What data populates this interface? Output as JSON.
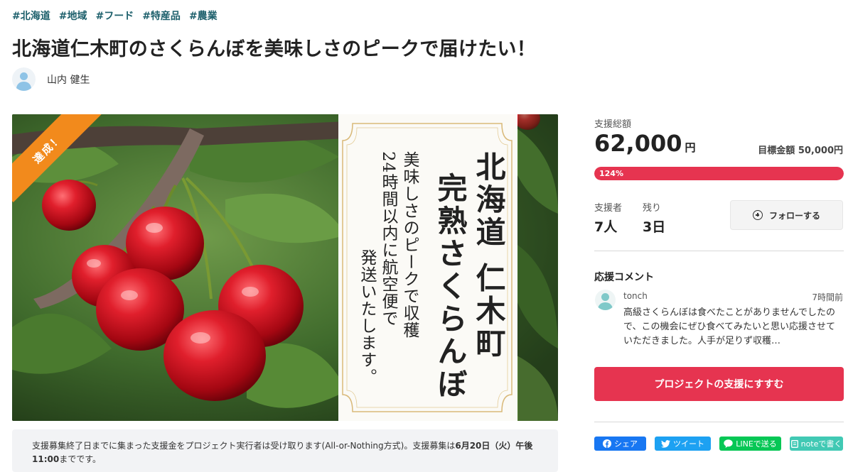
{
  "tags": [
    "#北海道",
    "#地域",
    "#フード",
    "#特産品",
    "#農業"
  ],
  "title": "北海道仁木町のさくらんぼを美味しさのピークで届けたい！",
  "owner": {
    "name": "山内 健生"
  },
  "hero": {
    "ribbon": "達成！",
    "poster_lines": [
      "北海道 仁木町",
      "完熟さくらんぼ",
      "美味しさのピークで収穫",
      "24時間以内に航空便で",
      "発送いたします。"
    ]
  },
  "notice": {
    "text_before": "支援募集終了日までに集まった支援金をプロジェクト実行者は受け取ります(All-or-Nothing方式)。支援募集は",
    "date_bold": "6月20日（火）午後11:00",
    "text_after": "までです。"
  },
  "funding": {
    "total_label": "支援総額",
    "total_amount": "62,000",
    "currency": "円",
    "goal_text": "目標金額 50,000円",
    "progress_label": "124%",
    "progress_fraction": 1.0
  },
  "stats": {
    "backers_label": "支援者",
    "backers_value": "7人",
    "remaining_label": "残り",
    "remaining_value": "3日"
  },
  "follow_button": "フォローする",
  "comments": {
    "title": "応援コメント",
    "items": [
      {
        "user": "tonch",
        "time": "7時間前",
        "text": "高級さくらんぼは食べたことがありませんでしたので、この機会にぜひ食べてみたいと思い応援させていただきました。人手が足りず収穫…"
      }
    ]
  },
  "cta_button": "プロジェクトの支援にすすむ",
  "share": {
    "facebook": "シェア",
    "twitter": "ツイート",
    "line": "LINEで送る",
    "note": "noteで書く"
  },
  "colors": {
    "accent": "#e63450",
    "tag": "#1c5f6b",
    "ribbon": "#f28a1c"
  }
}
